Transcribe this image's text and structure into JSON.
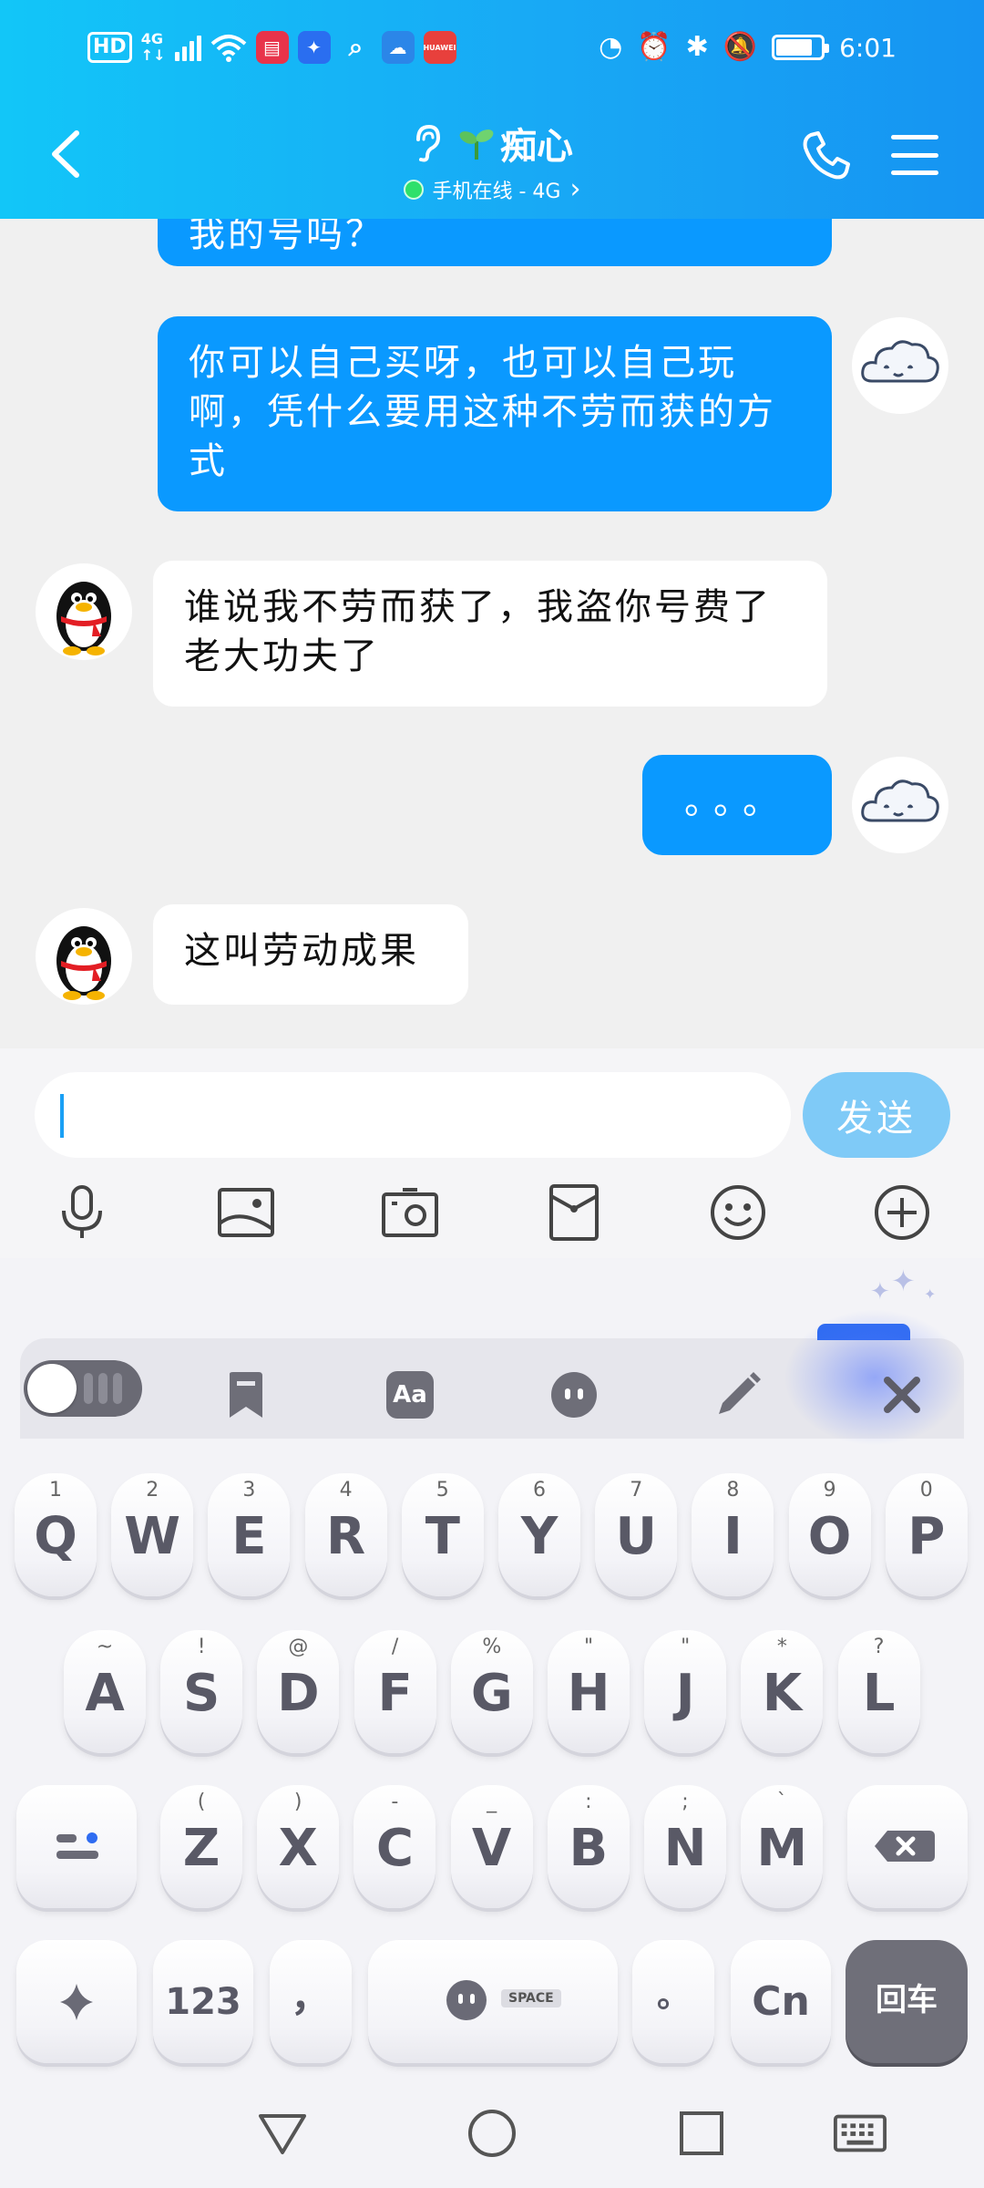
{
  "status_bar": {
    "hd": "HD",
    "net_type": "4G",
    "net_sub": "↑↓",
    "time": "6:01",
    "icons": [
      "hd-icon",
      "signal-icon",
      "wifi-icon",
      "book-app-icon",
      "bulb-app-icon",
      "search-app-icon",
      "weather-app-icon",
      "huawei-app-icon",
      "data-saver-icon",
      "alarm-icon",
      "bluetooth-icon",
      "mute-icon",
      "battery-icon"
    ],
    "app_huawei_text": "HUAWEI"
  },
  "header": {
    "contact_name": "痴心",
    "status_text": "手机在线 - 4G",
    "status_chevron": "›",
    "colors": {
      "gradient_start": "#12c6f8",
      "gradient_end": "#1694f2"
    }
  },
  "messages": [
    {
      "from": "me",
      "text": "我的号吗？"
    },
    {
      "from": "me",
      "text": "你可以自己买呀，也可以自己玩啊，凭什么要用这种不劳而获的方式"
    },
    {
      "from": "them",
      "text": "谁说我不劳而获了，我盗你号费了老大功夫了"
    },
    {
      "from": "me",
      "text": "。。。"
    },
    {
      "from": "them",
      "text": "这叫劳动成果"
    }
  ],
  "input": {
    "value": "",
    "send_label": "发送"
  },
  "toolbar_icons": [
    "voice-icon",
    "image-icon",
    "camera-icon",
    "red-packet-icon",
    "emoji-icon",
    "plus-icon"
  ],
  "keyboard": {
    "row1": [
      {
        "k": "Q",
        "s": "1"
      },
      {
        "k": "W",
        "s": "2"
      },
      {
        "k": "E",
        "s": "3"
      },
      {
        "k": "R",
        "s": "4"
      },
      {
        "k": "T",
        "s": "5"
      },
      {
        "k": "Y",
        "s": "6"
      },
      {
        "k": "U",
        "s": "7"
      },
      {
        "k": "I",
        "s": "8"
      },
      {
        "k": "O",
        "s": "9"
      },
      {
        "k": "P",
        "s": "0"
      }
    ],
    "row2": [
      {
        "k": "A",
        "s": "~"
      },
      {
        "k": "S",
        "s": "!"
      },
      {
        "k": "D",
        "s": "@"
      },
      {
        "k": "F",
        "s": "/"
      },
      {
        "k": "G",
        "s": "%"
      },
      {
        "k": "H",
        "s": "\""
      },
      {
        "k": "J",
        "s": "\""
      },
      {
        "k": "K",
        "s": "*"
      },
      {
        "k": "L",
        "s": "?"
      }
    ],
    "row3": [
      {
        "k": "Z",
        "s": "("
      },
      {
        "k": "X",
        "s": ")"
      },
      {
        "k": "C",
        "s": "-"
      },
      {
        "k": "V",
        "s": "_"
      },
      {
        "k": "B",
        "s": ":"
      },
      {
        "k": "N",
        "s": ";"
      },
      {
        "k": "M",
        "s": "`"
      }
    ],
    "key_123": "123",
    "key_comma": "，",
    "key_space": "SPACE",
    "key_period": "。",
    "key_cn": "Cn",
    "key_enter": "回车"
  },
  "keyboard_toolbar": {
    "toggle_state": "off",
    "aa_label": "Aa",
    "icons": [
      "mode-toggle",
      "bookmark-icon",
      "font-icon",
      "emoji-face-icon",
      "pen-icon",
      "close-icon"
    ]
  }
}
